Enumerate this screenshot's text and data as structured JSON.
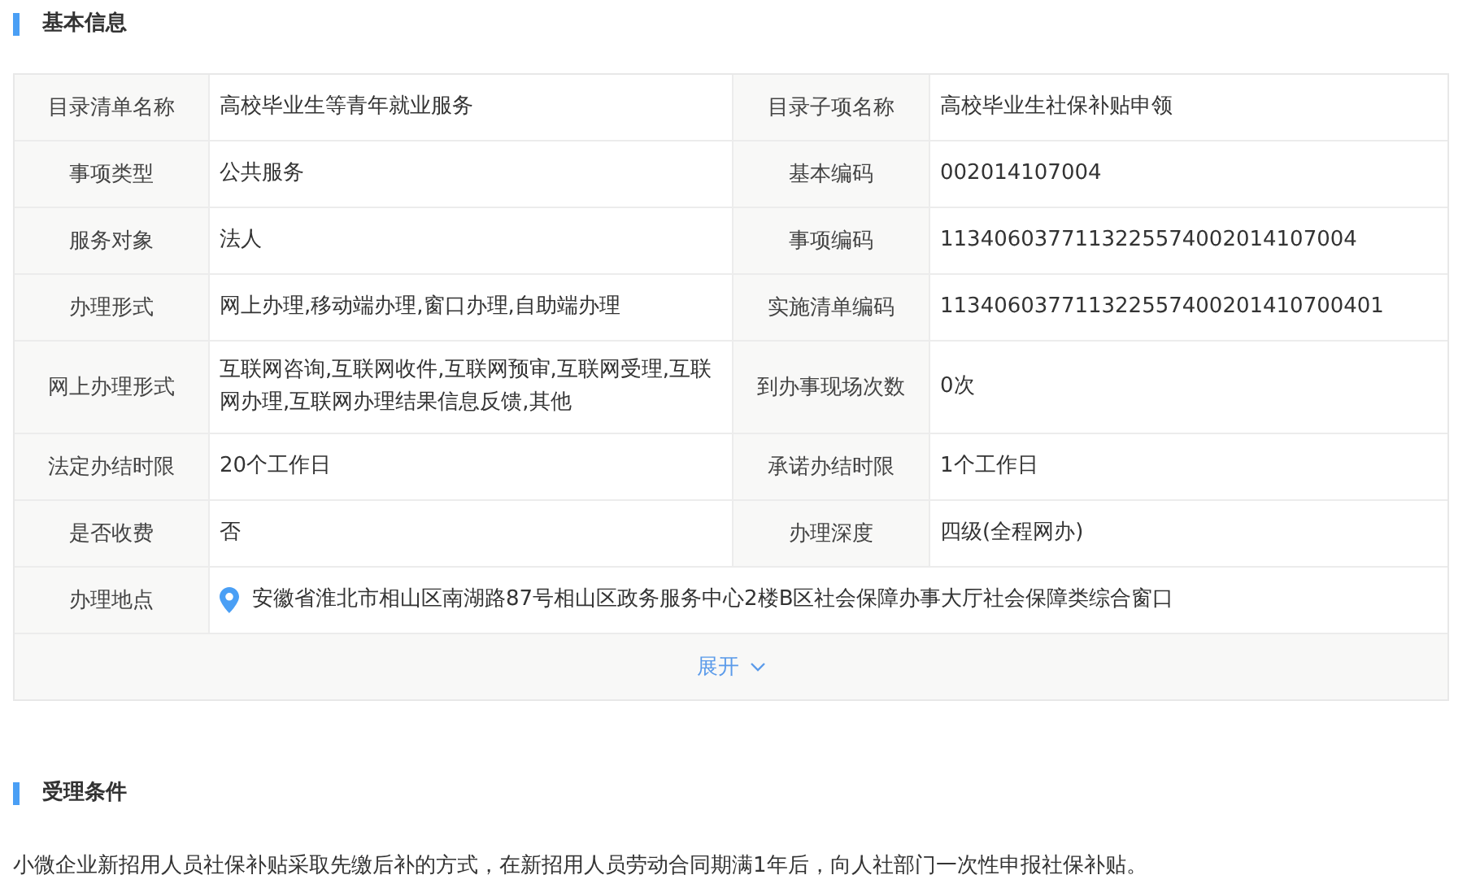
{
  "basic_info": {
    "title": "基本信息",
    "rows": [
      {
        "kind": "pair",
        "fields": [
          {
            "label": "目录清单名称",
            "value": "高校毕业生等青年就业服务"
          },
          {
            "label": "目录子项名称",
            "value": "高校毕业生社保补贴申领"
          }
        ]
      },
      {
        "kind": "pair",
        "fields": [
          {
            "label": "事项类型",
            "value": "公共服务"
          },
          {
            "label": "基本编码",
            "value": "002014107004"
          }
        ]
      },
      {
        "kind": "pair",
        "fields": [
          {
            "label": "服务对象",
            "value": "法人"
          },
          {
            "label": "事项编码",
            "value": "1134060377113225574002014107004"
          }
        ]
      },
      {
        "kind": "pair",
        "fields": [
          {
            "label": "办理形式",
            "value": "网上办理,移动端办理,窗口办理,自助端办理"
          },
          {
            "label": "实施清单编码",
            "value": "113406037711322557400201410700401"
          }
        ]
      },
      {
        "kind": "pair",
        "fields": [
          {
            "label": "网上办理形式",
            "value": "互联网咨询,互联网收件,互联网预审,互联网受理,互联网办理,互联网办理结果信息反馈,其他"
          },
          {
            "label": "到办事现场次数",
            "value": "0次"
          }
        ]
      },
      {
        "kind": "pair",
        "fields": [
          {
            "label": "法定办结时限",
            "value": "20个工作日"
          },
          {
            "label": "承诺办结时限",
            "value": "1个工作日"
          }
        ]
      },
      {
        "kind": "pair",
        "fields": [
          {
            "label": "是否收费",
            "value": "否"
          },
          {
            "label": "办理深度",
            "value": "四级(全程网办)"
          }
        ]
      },
      {
        "kind": "location",
        "fields": [
          {
            "label": "办理地点",
            "value": "安徽省淮北市相山区南湖路87号相山区政务服务中心2楼B区社会保障办事大厅社会保障类综合窗口"
          }
        ]
      }
    ],
    "expand_button": "展开"
  },
  "conditions": {
    "title": "受理条件",
    "text": "小微企业新招用人员社保补贴采取先缴后补的方式，在新招用人员劳动合同期满1年后，向人社部门一次性申报社保补贴。"
  }
}
